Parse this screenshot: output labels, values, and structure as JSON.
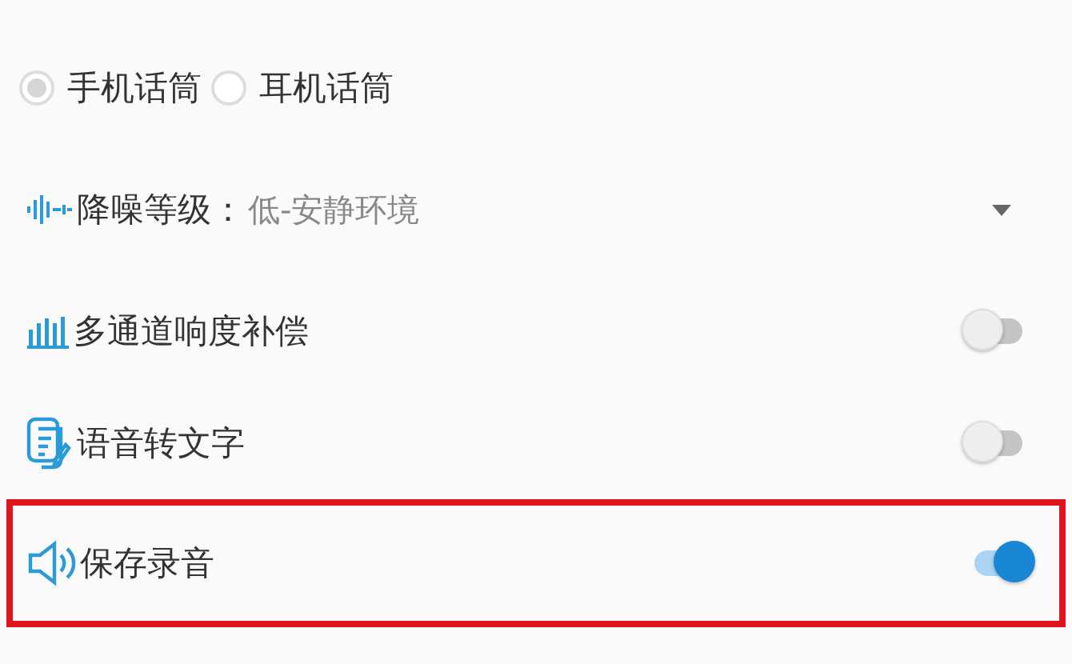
{
  "mic_options": [
    {
      "label": "手机话筒",
      "selected": true
    },
    {
      "label": "耳机话筒",
      "selected": false
    }
  ],
  "noise_reduction": {
    "label": "降噪等级：",
    "value": "低-安静环境"
  },
  "toggles": [
    {
      "label": "多通道响度补偿",
      "kind": "bars",
      "on": false,
      "highlighted": false
    },
    {
      "label": "语音转文字",
      "kind": "document",
      "on": false,
      "highlighted": false
    },
    {
      "label": "保存录音",
      "kind": "speaker",
      "on": true,
      "highlighted": true
    }
  ]
}
